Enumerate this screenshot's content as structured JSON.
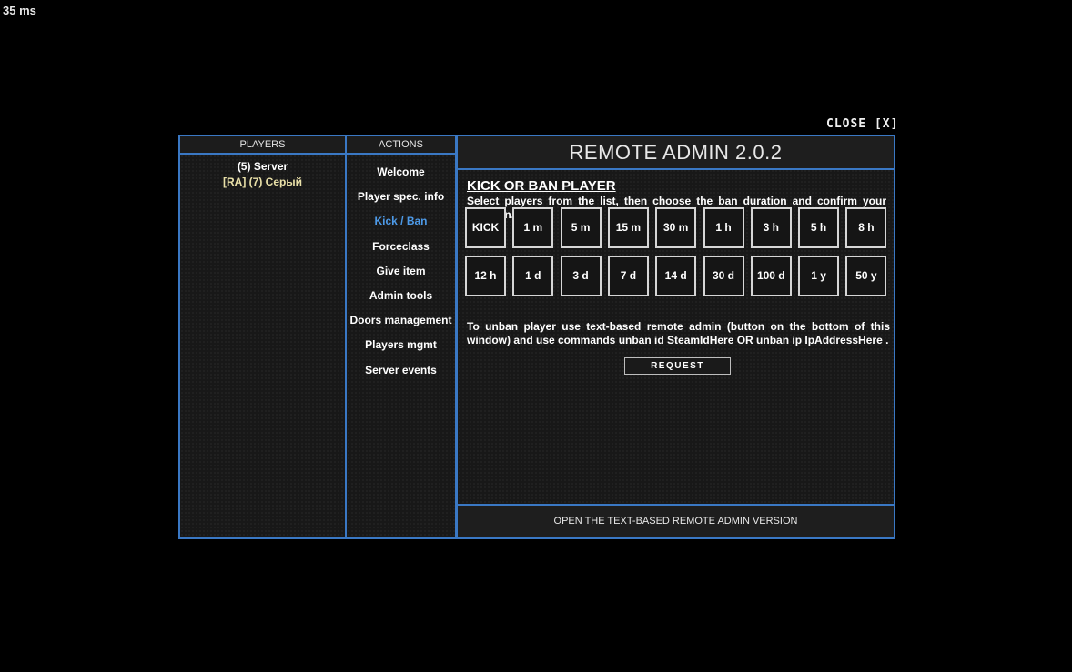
{
  "ping": "35 ms",
  "close_label": "CLOSE [X]",
  "players": {
    "header": "PLAYERS",
    "items": [
      {
        "label": "(5) Server",
        "kind": "server"
      },
      {
        "label": "[RA] (7) Серый",
        "kind": "ra"
      }
    ]
  },
  "actions": {
    "header": "ACTIONS",
    "items": [
      {
        "label": "Welcome",
        "active": false
      },
      {
        "label": "Player spec. info",
        "active": false
      },
      {
        "label": "Kick / Ban",
        "active": true
      },
      {
        "label": "Forceclass",
        "active": false
      },
      {
        "label": "Give item",
        "active": false
      },
      {
        "label": "Admin tools",
        "active": false
      },
      {
        "label": "Doors management",
        "active": false
      },
      {
        "label": "Players mgmt",
        "active": false
      },
      {
        "label": "Server events",
        "active": false
      }
    ]
  },
  "main": {
    "title": "REMOTE ADMIN 2.0.2",
    "section_title": "KICK OR BAN PLAYER",
    "description": "Select players from the list, then choose the ban duration and confirm your decision.",
    "durations_row1": [
      "KICK",
      "1 m",
      "5 m",
      "15 m",
      "30 m",
      "1 h",
      "3 h",
      "5 h",
      "8 h"
    ],
    "durations_row2": [
      "12 h",
      "1 d",
      "3 d",
      "7 d",
      "14 d",
      "30 d",
      "100 d",
      "1 y",
      "50 y"
    ],
    "unban_text": "To unban player use text-based remote admin (button on the bottom of this window) and use commands unban id SteamIdHere OR unban ip IpAddressHere .",
    "request_label": "REQUEST",
    "footer_label": "OPEN THE TEXT-BASED REMOTE ADMIN VERSION"
  },
  "colors": {
    "accent_border": "#3a78c4",
    "active_action": "#4d9ae8",
    "ra_player": "#e9e0a8",
    "background": "#000000"
  }
}
